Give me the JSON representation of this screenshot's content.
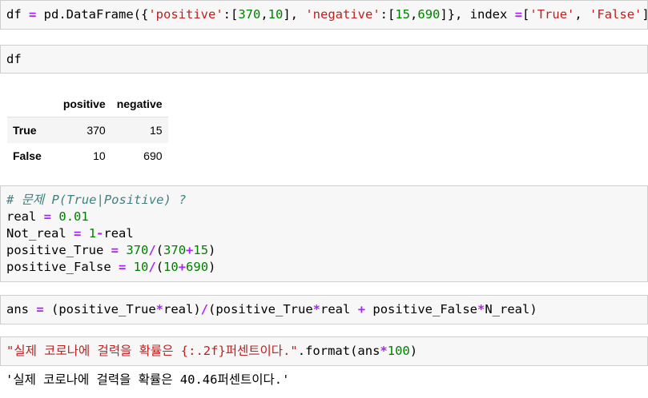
{
  "cells": {
    "c1": {
      "line": [
        "df ",
        "=",
        " pd.DataFrame({",
        "'positive'",
        ":[",
        "370",
        ",",
        "10",
        "], ",
        "'negative'",
        ":[",
        "15",
        ",",
        "690",
        "]}, index ",
        "=",
        "[",
        "'True'",
        ", ",
        "'False'",
        "] )"
      ]
    },
    "c2": {
      "line": "df"
    },
    "c3": {
      "comment": "# 문제 P(True|Positive) ?",
      "l2": [
        "real ",
        "=",
        " ",
        "0.01"
      ],
      "l3": [
        "Not_real ",
        "=",
        " ",
        "1",
        "-",
        "real"
      ],
      "l4": [
        "positive_True ",
        "=",
        " ",
        "370",
        "/",
        "(",
        "370",
        "+",
        "15",
        ")"
      ],
      "l5": [
        "positive_False ",
        "=",
        " ",
        "10",
        "/",
        "(",
        "10",
        "+",
        "690",
        ")"
      ]
    },
    "c4": {
      "line": [
        "ans ",
        "=",
        " (positive_True",
        "*",
        "real)",
        "/",
        "(positive_True",
        "*",
        "real ",
        "+",
        " positive_False",
        "*",
        "N_real)"
      ]
    },
    "c5": {
      "line": [
        "\"실제 코로나에 걸력을 확률은 {:.2f}퍼센트이다.\"",
        ".format(ans",
        "*",
        "100",
        ")"
      ]
    }
  },
  "dataframe": {
    "columns": [
      "positive",
      "negative"
    ],
    "rows": [
      {
        "index": "True",
        "positive": "370",
        "negative": "15"
      },
      {
        "index": "False",
        "positive": "10",
        "negative": "690"
      }
    ]
  },
  "output_text": "'실제 코로나에 걸력을 확률은 40.46퍼센트이다.'",
  "colors": {
    "string": "#ba2121",
    "number": "#008000",
    "operator": "#aa22ff",
    "comment": "#408080",
    "cell_bg": "#f7f7f7"
  }
}
